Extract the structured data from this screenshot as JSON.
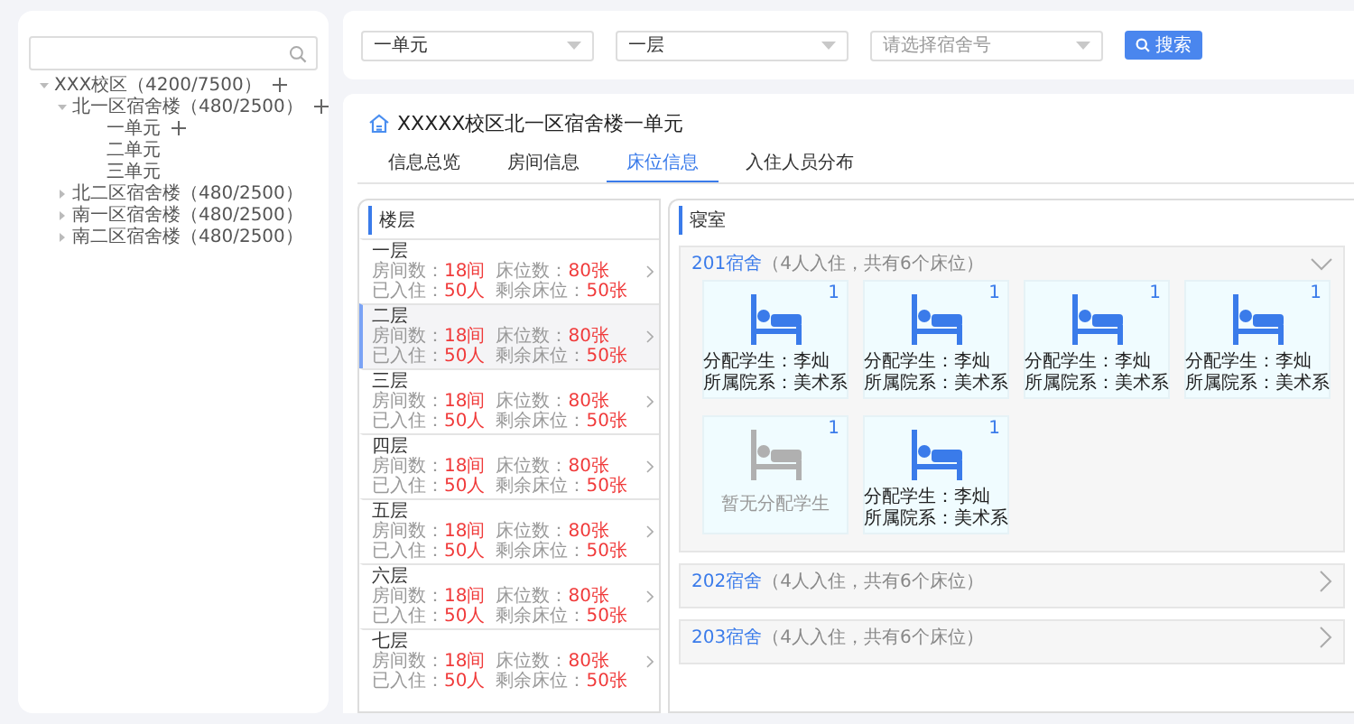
{
  "sidebar": {
    "tree": [
      {
        "label": "XXX校区（4200/7500）",
        "expanded": true,
        "addable": true,
        "children": [
          {
            "label": "北一区宿舍楼（480/2500）",
            "expanded": true,
            "addable": true,
            "children": [
              {
                "label": "一单元",
                "addable": true
              },
              {
                "label": "二单元",
                "addable": false
              },
              {
                "label": "三单元",
                "addable": false
              }
            ]
          },
          {
            "label": "北二区宿舍楼（480/2500）",
            "expanded": false,
            "addable": false
          },
          {
            "label": "南一区宿舍楼（480/2500）",
            "expanded": false,
            "addable": false
          },
          {
            "label": "南二区宿舍楼（480/2500）",
            "expanded": false,
            "addable": false
          }
        ]
      }
    ]
  },
  "filters": {
    "selects_all": [
      {
        "value": "一单元"
      },
      {
        "value": "一层"
      },
      {
        "placeholder": "请选择宿舍号"
      }
    ],
    "search_button": "搜索"
  },
  "main": {
    "title": "XXXXX校区北一区宿舍楼一单元",
    "tabs": [
      {
        "label": "信息总览",
        "selected": false
      },
      {
        "label": "房间信息",
        "selected": false
      },
      {
        "label": "床位信息",
        "selected": true
      },
      {
        "label": "入住人员分布",
        "selected": false
      }
    ],
    "floors_heading": "楼层",
    "floors": [
      {
        "name": "一层",
        "selected": false,
        "stats": [
          {
            "label": "房间数：",
            "value": "18间"
          },
          {
            "label": "床位数：",
            "value": "80张"
          },
          {
            "label": "已入住：",
            "value": "50人"
          },
          {
            "label": "剩余床位：",
            "value": "50张"
          }
        ]
      },
      {
        "name": "二层",
        "selected": true,
        "stats": [
          {
            "label": "房间数：",
            "value": "18间"
          },
          {
            "label": "床位数：",
            "value": "80张"
          },
          {
            "label": "已入住：",
            "value": "50人"
          },
          {
            "label": "剩余床位：",
            "value": "50张"
          }
        ]
      },
      {
        "name": "三层",
        "selected": false,
        "stats": [
          {
            "label": "房间数：",
            "value": "18间"
          },
          {
            "label": "床位数：",
            "value": "80张"
          },
          {
            "label": "已入住：",
            "value": "50人"
          },
          {
            "label": "剩余床位：",
            "value": "50张"
          }
        ]
      },
      {
        "name": "四层",
        "selected": false,
        "stats": [
          {
            "label": "房间数：",
            "value": "18间"
          },
          {
            "label": "床位数：",
            "value": "80张"
          },
          {
            "label": "已入住：",
            "value": "50人"
          },
          {
            "label": "剩余床位：",
            "value": "50张"
          }
        ]
      },
      {
        "name": "五层",
        "selected": false,
        "stats": [
          {
            "label": "房间数：",
            "value": "18间"
          },
          {
            "label": "床位数：",
            "value": "80张"
          },
          {
            "label": "已入住：",
            "value": "50人"
          },
          {
            "label": "剩余床位：",
            "value": "50张"
          }
        ]
      },
      {
        "name": "六层",
        "selected": false,
        "stats": [
          {
            "label": "房间数：",
            "value": "18间"
          },
          {
            "label": "床位数：",
            "value": "80张"
          },
          {
            "label": "已入住：",
            "value": "50人"
          },
          {
            "label": "剩余床位：",
            "value": "50张"
          }
        ]
      },
      {
        "name": "七层",
        "selected": false,
        "stats": [
          {
            "label": "房间数：",
            "value": "18间"
          },
          {
            "label": "床位数：",
            "value": "80张"
          },
          {
            "label": "已入住：",
            "value": "50人"
          },
          {
            "label": "剩余床位：",
            "value": "50张"
          }
        ]
      }
    ],
    "rooms_heading": "寝室",
    "rooms": [
      {
        "name": "201宿舍",
        "detail": "（4人入住，共有6个床位）",
        "expanded": true,
        "beds": [
          {
            "kind": "assigned",
            "number": "1",
            "lines": [
              "分配学生：李灿",
              "所属院系：美术系"
            ]
          },
          {
            "kind": "assigned",
            "number": "1",
            "lines": [
              "分配学生：李灿",
              "所属院系：美术系"
            ]
          },
          {
            "kind": "assigned",
            "number": "1",
            "lines": [
              "分配学生：李灿",
              "所属院系：美术系"
            ]
          },
          {
            "kind": "assigned",
            "number": "1",
            "lines": [
              "分配学生：李灿",
              "所属院系：美术系"
            ]
          },
          {
            "kind": "empty",
            "number": "1",
            "lines": [
              "暂无分配学生"
            ]
          },
          {
            "kind": "assigned",
            "number": "1",
            "lines": [
              "分配学生：李灿",
              "所属院系：美术系"
            ]
          }
        ]
      },
      {
        "name": "202宿舍",
        "detail": "（4人入住，共有6个床位）",
        "expanded": false
      },
      {
        "name": "203宿舍",
        "detail": "（4人入住，共有6个床位）",
        "expanded": false
      }
    ]
  }
}
